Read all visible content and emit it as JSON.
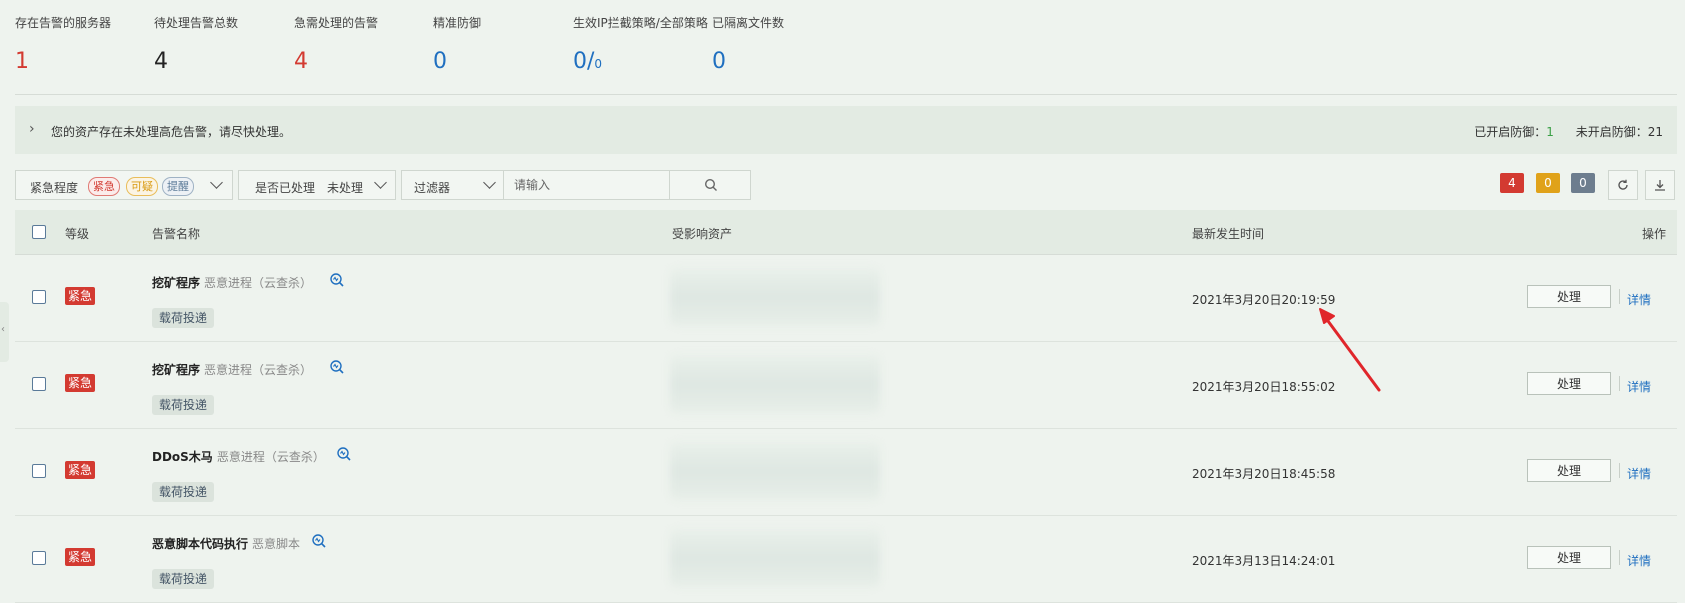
{
  "stats": [
    {
      "label": "存在告警的服务器",
      "value": "1",
      "color": "#d33a31"
    },
    {
      "label": "待处理告警总数",
      "value": "4",
      "color": "#222222"
    },
    {
      "label": "急需处理的告警",
      "value": "4",
      "color": "#d33a31"
    },
    {
      "label": "精准防御",
      "value": "0",
      "color": "#1f6fc0"
    },
    {
      "label": "生效IP拦截策略/全部策略",
      "value": "0/",
      "value_small": "0",
      "color": "#1f6fc0"
    },
    {
      "label": "已隔离文件数",
      "value": "0",
      "color": "#1f6fc0"
    }
  ],
  "notice": {
    "message": "您的资产存在未处理高危告警，请尽快处理。",
    "enabled_label": "已开启防御：",
    "enabled_count": "1",
    "disabled_label": "未开启防御：",
    "disabled_count": "21"
  },
  "filters": {
    "severity_label": "紧急程度",
    "severity_tags": [
      "紧急",
      "可疑",
      "提醒"
    ],
    "handled_label": "是否已处理",
    "handled_value": "未处理",
    "filter_label": "过滤器",
    "search_placeholder": "请输入"
  },
  "counts": {
    "urgent": "4",
    "suspicious": "0",
    "reminder": "0"
  },
  "table": {
    "headers": {
      "level": "等级",
      "name": "告警名称",
      "asset": "受影响资产",
      "time": "最新发生时间",
      "action": "操作"
    },
    "rows": [
      {
        "level": "紧急",
        "name": "挖矿程序",
        "sub": "恶意进程（云查杀）",
        "tag": "载荷投递",
        "time": "2021年3月20日20:19:59",
        "handle": "处理",
        "detail": "详情"
      },
      {
        "level": "紧急",
        "name": "挖矿程序",
        "sub": "恶意进程（云查杀）",
        "tag": "载荷投递",
        "time": "2021年3月20日18:55:02",
        "handle": "处理",
        "detail": "详情"
      },
      {
        "level": "紧急",
        "name": "DDoS木马",
        "sub": "恶意进程（云查杀）",
        "tag": "载荷投递",
        "time": "2021年3月20日18:45:58",
        "handle": "处理",
        "detail": "详情"
      },
      {
        "level": "紧急",
        "name": "恶意脚本代码执行",
        "sub": "恶意脚本",
        "tag": "载荷投递",
        "time": "2021年3月13日14:24:01",
        "handle": "处理",
        "detail": "详情"
      }
    ]
  },
  "colors": {
    "urgent": "#d33a31",
    "link": "#1f6fc0",
    "annotation_arrow": "#e0262b"
  }
}
